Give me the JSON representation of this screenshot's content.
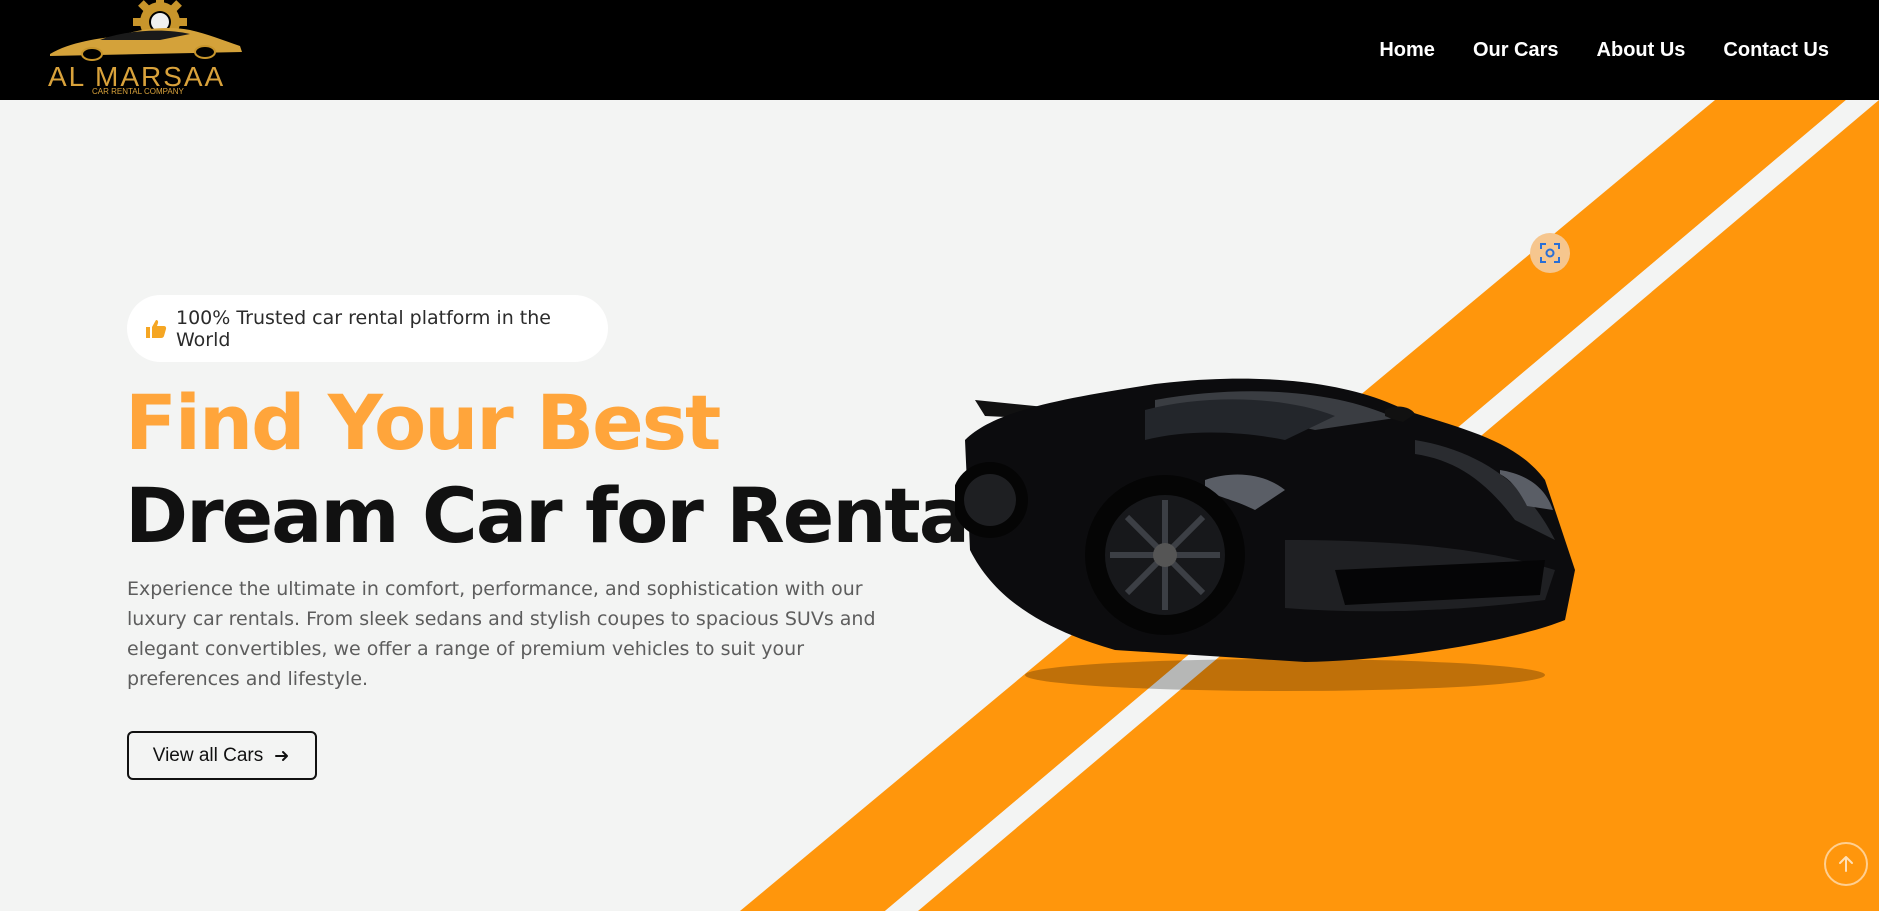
{
  "brand": {
    "name": "AL MARSAA",
    "tagline": "CAR RENTAL COMPANY"
  },
  "nav": {
    "items": [
      {
        "label": "Home"
      },
      {
        "label": "Our Cars"
      },
      {
        "label": "About Us"
      },
      {
        "label": "Contact Us"
      }
    ]
  },
  "hero": {
    "badge_text": "100% Trusted car rental platform in the World",
    "badge_icon": "thumbs-up-icon",
    "title_line_1": "Find Your Best",
    "title_line_2": "Dream Car for Rental",
    "description": "Experience the ultimate in comfort, performance, and sophistication with our luxury car rentals. From sleek sedans and stylish coupes to spacious SUVs and elegant convertibles, we offer a range of premium vehicles to suit your preferences and lifestyle.",
    "cta_label": "View all Cars",
    "cta_icon": "arrow-right-icon"
  },
  "colors": {
    "accent_orange": "#ffa53b",
    "stripe_orange": "#ff960c",
    "nav_bg": "#000000",
    "hero_bg": "#f3f4f3"
  }
}
